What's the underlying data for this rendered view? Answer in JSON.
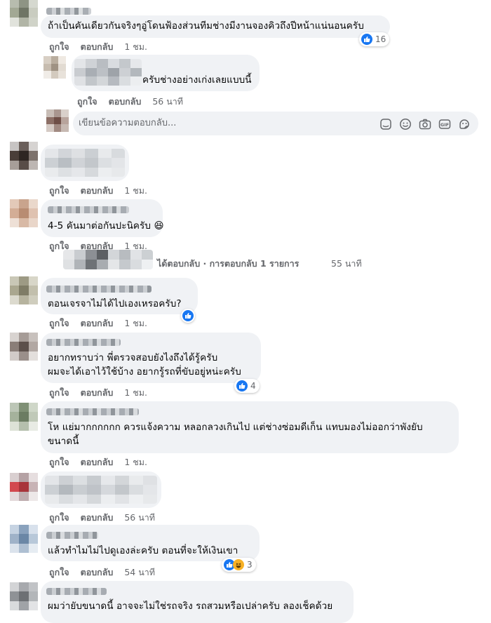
{
  "comments": [
    {
      "text": "ถ้าเป็นคันเดียวกันจริงๆอู่โดนฟ้องส่วนทีมช่างมีงานจองคิวถึงปีหน้าแน่นอนครับ",
      "like": "ถูกใจ",
      "reply": "ตอบกลับ",
      "time": "1 ชม.",
      "reactions": "16"
    },
    {
      "text": "ครับช่างอย่างเก่งเลยแบบนี้",
      "like": "ถูกใจ",
      "reply": "ตอบกลับ",
      "time": "56 นาที"
    },
    {
      "like": "ถูกใจ",
      "reply": "ตอบกลับ",
      "time": "1 ชม."
    },
    {
      "text": "4-5 คันมาต่อกันปะนิครับ 😆",
      "like": "ถูกใจ",
      "reply": "ตอบกลับ",
      "time": "1 ชม."
    },
    {
      "text": "ตอนเจรจาไม่ได้ไปเองเหรอครับ?",
      "like": "ถูกใจ",
      "reply": "ตอบกลับ",
      "time": "1 ชม."
    },
    {
      "text1": "อยากทราบว่า พี่ตรวจสอบยังไงถึงได้รู้ครับ",
      "text2": "ผมจะได้เอาไว้ใช้บ้าง อยากรู้รถที่ขับอยู่หน่ะครับ",
      "like": "ถูกใจ",
      "reply": "ตอบกลับ",
      "time": "1 ชม.",
      "reactions": "4"
    },
    {
      "text1": "โห แย่มากกกกกก ควรแจ้งความ หลอกลวงเกินไป แต่ช่างซ่อมดีเก็น แทบมองไม่ออกว่าพังยับ",
      "text2": "ขนาดนี้",
      "like": "ถูกใจ",
      "reply": "ตอบกลับ",
      "time": "1 ชม."
    },
    {
      "like": "ถูกใจ",
      "reply": "ตอบกลับ",
      "time": "56 นาที"
    },
    {
      "text": "แล้วทำไมไม่ไปดูเองล่ะครับ ตอนที่จะให้เงินเขา",
      "like": "ถูกใจ",
      "reply": "ตอบกลับ",
      "time": "54 นาที",
      "reactions": "3"
    },
    {
      "text": "ผมว่ายับขนาดนี้ อาจจะไม่ใช่รถจริง รถสวมหรือเปล่าครับ ลองเช็คด้วย"
    }
  ],
  "reply_box": {
    "placeholder": "เขียนข้อความตอบกลับ..."
  },
  "view_replies": {
    "text": "ได้ตอบกลับ · การตอบกลับ 1 รายการ",
    "time": "55 นาที"
  },
  "colors": {
    "bubble": "#f0f2f5",
    "meta": "#65676b",
    "like_blue": "#1877f2",
    "haha_yellow": "#f7b125"
  },
  "icons": [
    "like-icon",
    "haha-icon",
    "sticker-icon",
    "emoji-icon",
    "camera-icon",
    "gif-icon",
    "avatar-sticker-icon"
  ]
}
